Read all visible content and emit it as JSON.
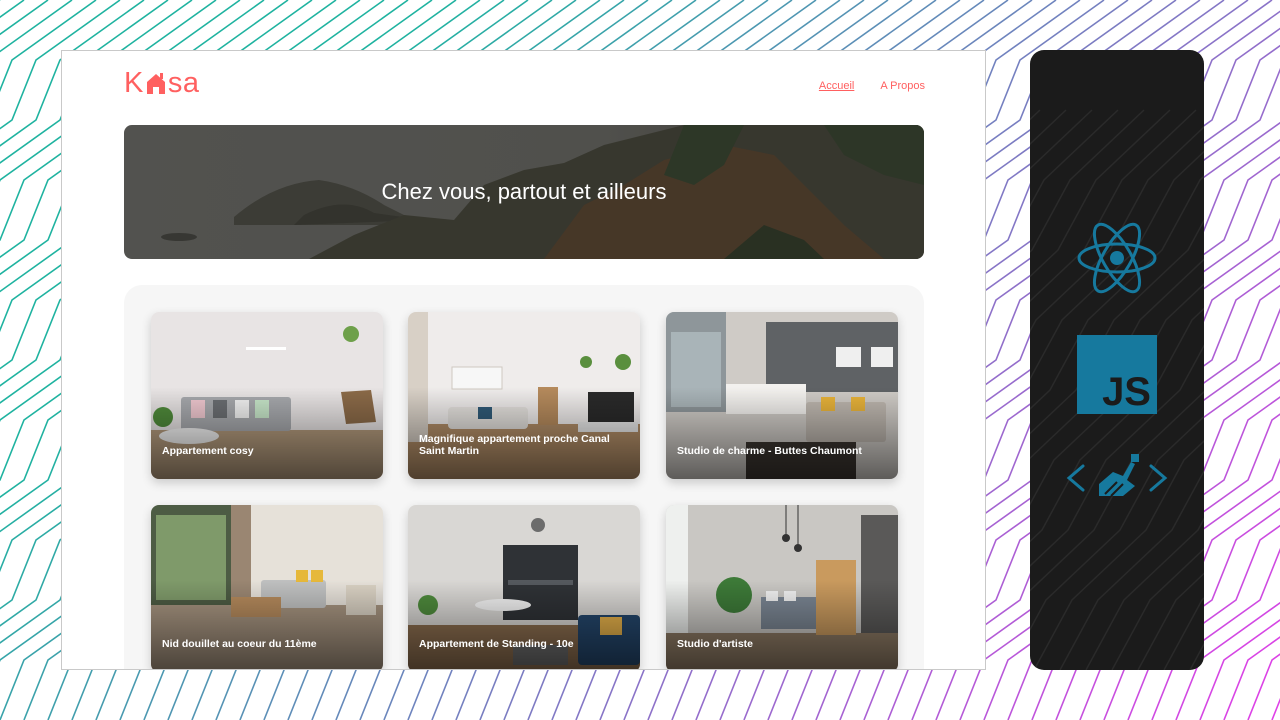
{
  "logo": {
    "text_left": "K",
    "text_right": "sa",
    "house_icon": "house-icon"
  },
  "nav": {
    "items": [
      {
        "label": "Accueil",
        "active": true
      },
      {
        "label": "A Propos",
        "active": false
      }
    ]
  },
  "banner": {
    "title": "Chez vous, partout et ailleurs"
  },
  "listings": [
    {
      "title": "Appartement cosy"
    },
    {
      "title": "Magnifique appartement proche Canal Saint Martin"
    },
    {
      "title": "Studio de charme - Buttes Chaumont"
    },
    {
      "title": "Nid douillet au coeur du 11ème"
    },
    {
      "title": "Appartement de Standing - 10e"
    },
    {
      "title": "Studio d'artiste"
    }
  ],
  "tech_stack": [
    {
      "icon": "react-icon"
    },
    {
      "icon": "javascript-icon",
      "label": "JS"
    },
    {
      "icon": "sass-icon"
    }
  ],
  "colors": {
    "brand": "#ff6060",
    "panel": "#1b1b1b",
    "tech_blue": "#16799e"
  }
}
